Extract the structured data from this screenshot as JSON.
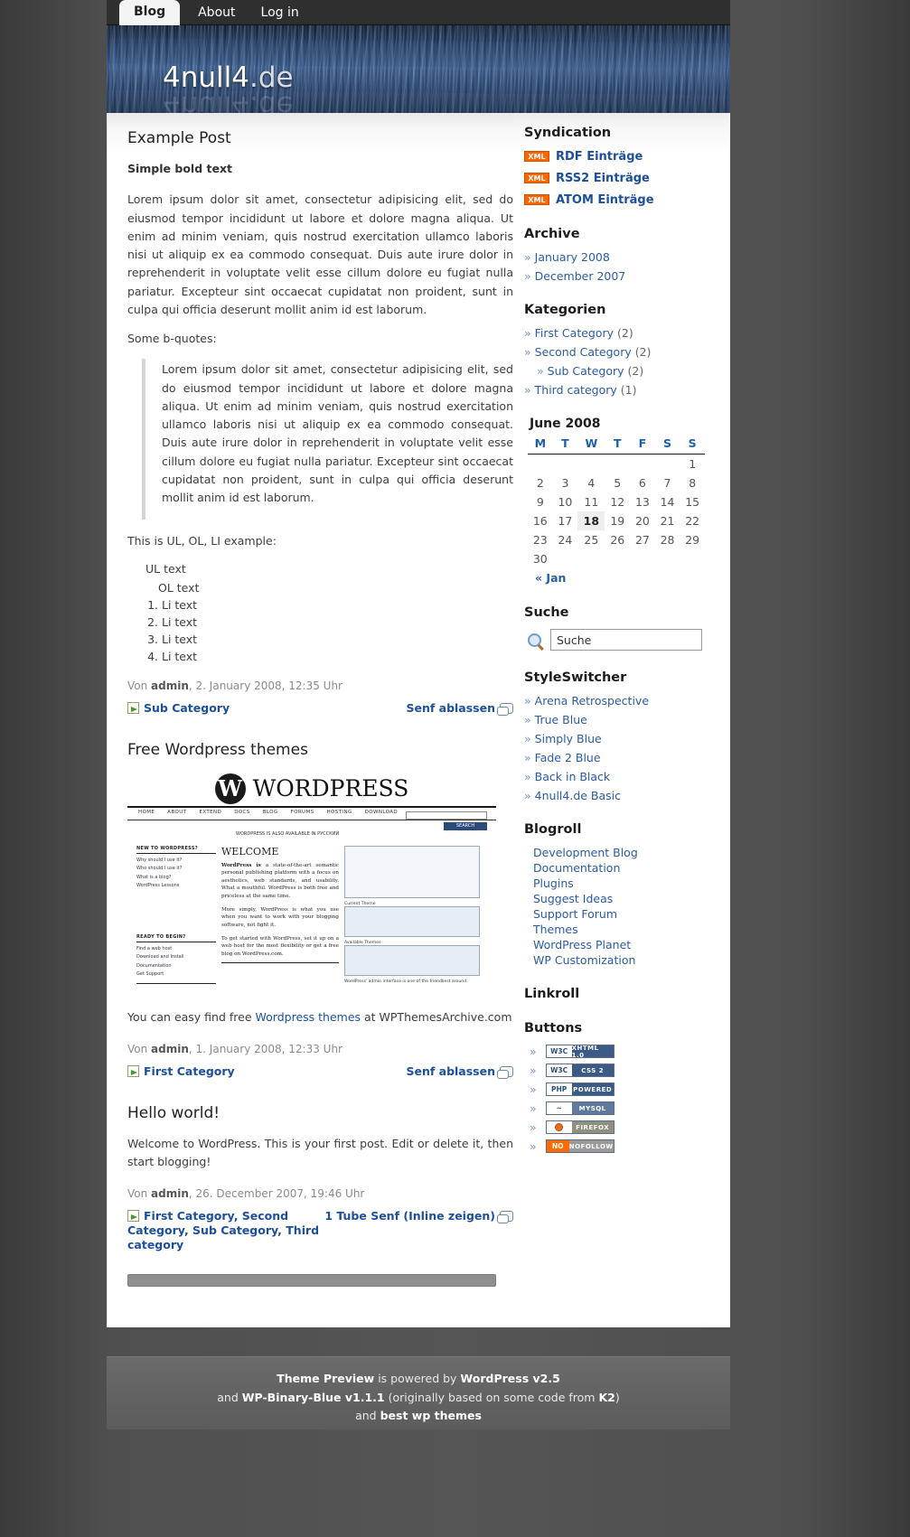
{
  "nav": {
    "items": [
      {
        "label": "Blog",
        "current": true
      },
      {
        "label": "About",
        "current": false
      },
      {
        "label": "Log in",
        "current": false
      }
    ]
  },
  "header": {
    "title_strong": "4null4",
    "title_dim": ".de",
    "title_full": "4null4.de"
  },
  "posts": [
    {
      "title": "Example Post",
      "bold_lead": "Simple bold text",
      "body": "Lorem ipsum dolor sit amet, consectetur adipisicing elit, sed do eiusmod tempor incididunt ut labore et dolore magna aliqua. Ut enim ad minim veniam, quis nostrud exercitation ullamco laboris nisi ut aliquip ex ea commodo consequat. Duis aute irure dolor in reprehenderit in voluptate velit esse cillum dolore eu fugiat nulla pariatur. Excepteur sint occaecat cupidatat non proident, sunt in culpa qui officia deserunt mollit anim id est laborum.",
      "quote_intro": "Some b-quotes:",
      "quote": "Lorem ipsum dolor sit amet, consectetur adipisicing elit, sed do eiusmod tempor incididunt ut labore et dolore magna aliqua. Ut enim ad minim veniam, quis nostrud exercitation ullamco laboris nisi ut aliquip ex ea commodo consequat. Duis aute irure dolor in reprehenderit in voluptate velit esse cillum dolore eu fugiat nulla pariatur. Excepteur sint occaecat cupidatat non proident, sunt in culpa qui officia deserunt mollit anim id est laborum.",
      "list_intro": "This is UL, OL, LI example:",
      "ul_text": "UL text",
      "ol_text": "OL text",
      "li_items": [
        "Li text",
        "Li text",
        "Li text",
        "Li text"
      ],
      "meta_prefix": "Von ",
      "meta_author": "admin",
      "meta_rest": ", 2. January 2008, 12:35 Uhr",
      "category": "Sub Category",
      "comments": "Senf ablassen"
    },
    {
      "title": "Free Wordpress themes",
      "caption_before": "You can easy find free ",
      "caption_link": "Wordpress themes",
      "caption_after": " at WPThemesArchive.com",
      "meta_prefix": "Von ",
      "meta_author": "admin",
      "meta_rest": ", 1. January 2008, 12:33 Uhr",
      "category": "First Category",
      "comments": "Senf ablassen"
    },
    {
      "title": "Hello world!",
      "body": "Welcome to WordPress. This is your first post. Edit or delete it, then start blogging!",
      "meta_prefix": "Von ",
      "meta_author": "admin",
      "meta_rest": ", 26. December 2007, 19:46 Uhr",
      "category": "First Category, Second Category, Sub Category, Third category",
      "comments": "1 Tube Senf (Inline zeigen)"
    }
  ],
  "wp_shot": {
    "logo_letter": "W",
    "wordmark": "WORDPRESS",
    "nav": [
      "HOME",
      "ABOUT",
      "EXTEND",
      "DOCS",
      "BLOG",
      "FORUMS",
      "HOSTING",
      "DOWNLOAD"
    ],
    "search_button": "SEARCH",
    "notice": "WORDPRESS IS ALSO AVAILABLE IN РУССКИЙ",
    "welcome": "WELCOME",
    "intro_lead": "WordPress is",
    "intro": "a state-of-the-art semantic personal publishing platform with a focus on aesthetics, web standards, and usability. What a mouthful. WordPress is both free and priceless at the same time.",
    "intro2": "More simply, WordPress is what you use when you want to work with your blogging software, not fight it.",
    "started": "To get started with WordPress, set it up on a web host for the most flexibility or get a free blog on WordPress.com.",
    "col1_h1": "NEW TO WORDPRESS?",
    "col1_l1": [
      "Why should I use it?",
      "Who should I use it?",
      "What is a blog?",
      "WordPress Lessons"
    ],
    "col1_h2": "READY TO BEGIN?",
    "col1_l2": [
      "Find a web host",
      "Download and Install",
      "Documentation",
      "Get Support"
    ],
    "col3_h": "Current Theme",
    "col3_sub": "Available Themes",
    "caption": "WordPress' admin interface is one of the friendliest around."
  },
  "sidebar": {
    "syndication": {
      "title": "Syndication",
      "badge": "XML",
      "items": [
        "RDF Einträge",
        "RSS2 Einträge",
        "ATOM Einträge"
      ]
    },
    "archive": {
      "title": "Archive",
      "items": [
        "January 2008",
        "December 2007"
      ]
    },
    "kategorien": {
      "title": "Kategorien",
      "items": [
        {
          "label": "First Category",
          "count": "(2)",
          "sub": false
        },
        {
          "label": "Second Category",
          "count": "(2)",
          "sub": false
        },
        {
          "label": "Sub Category",
          "count": "(2)",
          "sub": true
        },
        {
          "label": "Third category",
          "count": "(1)",
          "sub": false
        }
      ]
    },
    "calendar": {
      "title": "June 2008",
      "weekdays": [
        "M",
        "T",
        "W",
        "T",
        "F",
        "S",
        "S"
      ],
      "weeks": [
        [
          "",
          "",
          "",
          "",
          "",
          "",
          "1"
        ],
        [
          "2",
          "3",
          "4",
          "5",
          "6",
          "7",
          "8"
        ],
        [
          "9",
          "10",
          "11",
          "12",
          "13",
          "14",
          "15"
        ],
        [
          "16",
          "17",
          "18",
          "19",
          "20",
          "21",
          "22"
        ],
        [
          "23",
          "24",
          "25",
          "26",
          "27",
          "28",
          "29"
        ],
        [
          "30",
          "",
          "",
          "",
          "",
          "",
          ""
        ]
      ],
      "today": "18",
      "prev": "« Jan"
    },
    "suche": {
      "title": "Suche",
      "value": "Suche",
      "placeholder": "Suche"
    },
    "styleswitcher": {
      "title": "StyleSwitcher",
      "items": [
        "Arena Retrospective",
        "True Blue",
        "Simply Blue",
        "Fade 2 Blue",
        "Back in Black",
        "4null4.de Basic"
      ]
    },
    "blogroll": {
      "title": "Blogroll",
      "items": [
        "Development Blog",
        "Documentation",
        "Plugins",
        "Suggest Ideas",
        "Support Forum",
        "Themes",
        "WordPress Planet",
        "WP Customization"
      ]
    },
    "linkroll": {
      "title": "Linkroll"
    },
    "buttons": {
      "title": "Buttons",
      "items": [
        {
          "left": "W3C",
          "right": "XHTML 1.0",
          "kind": "w3c"
        },
        {
          "left": "W3C",
          "right": "CSS 2",
          "kind": "w3c"
        },
        {
          "left": "PHP",
          "right": "POWERED",
          "kind": "php"
        },
        {
          "left": "",
          "right": "MYSQL",
          "kind": "mysql"
        },
        {
          "left": "",
          "right": "FIREFOX",
          "kind": "firefox"
        },
        {
          "left": "NO",
          "right": "NOFOLLOW",
          "kind": "nofollow"
        }
      ]
    }
  },
  "footer": {
    "line1_a": "Theme Preview",
    "line1_b": " is powered by ",
    "line1_c": "WordPress v2.5",
    "line2_a": "and ",
    "line2_b": "WP-Binary-Blue v1.1.1",
    "line2_c": " (originally based on some code from ",
    "line2_d": "K2",
    "line2_e": ")",
    "line3_a": "and ",
    "line3_b": "best wp themes"
  }
}
